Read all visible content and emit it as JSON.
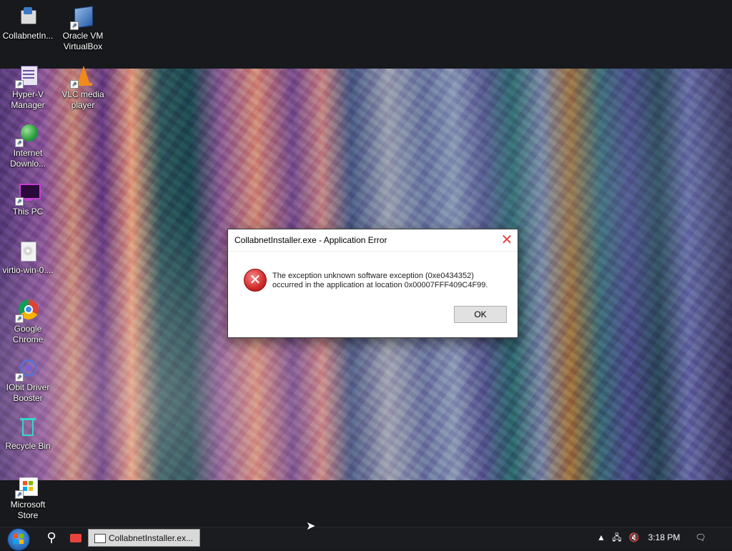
{
  "desktop": {
    "icons": [
      {
        "label_line1": "CollabnetIn...",
        "label_line2": ""
      },
      {
        "label_line1": "Oracle VM",
        "label_line2": "VirtualBox"
      },
      {
        "label_line1": "Hyper-V",
        "label_line2": "Manager"
      },
      {
        "label_line1": "VLC media",
        "label_line2": "player"
      },
      {
        "label_line1": "Internet",
        "label_line2": "Downlo..."
      },
      {
        "label_line1": "This PC",
        "label_line2": ""
      },
      {
        "label_line1": "virtio-win-0....",
        "label_line2": ""
      },
      {
        "label_line1": "Google",
        "label_line2": "Chrome"
      },
      {
        "label_line1": "IObit Driver",
        "label_line2": "Booster"
      },
      {
        "label_line1": "Recycle Bin",
        "label_line2": ""
      },
      {
        "label_line1": "Microsoft",
        "label_line2": "Store"
      }
    ]
  },
  "dialog": {
    "title": "CollabnetInstaller.exe - Application Error",
    "close_glyph": "✕",
    "message_line1": "The exception unknown software exception (0xe0434352)",
    "message_line2": "occurred in the application at location 0x00007FFF409C4F99.",
    "ok_label": "OK"
  },
  "taskbar": {
    "search_glyph": "⚲",
    "task_item_label": "CollabnetInstaller.ex...",
    "tray": {
      "up_glyph": "▲",
      "network_glyph": "🖧",
      "volume_glyph": "🔇",
      "clock": "3:18 PM",
      "notifications_glyph": "🗨"
    }
  }
}
